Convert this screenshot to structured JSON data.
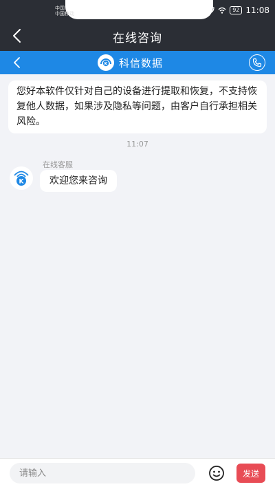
{
  "status_bar": {
    "carrier_line1": "中国",
    "carrier_line2": "中国移动",
    "battery": "92",
    "time": "11:08"
  },
  "nav": {
    "title": "在线咨询"
  },
  "sub_nav": {
    "brand_name": "科信数据",
    "accent_color": "#1e88e5"
  },
  "chat": {
    "notice": "您好本软件仅针对自己的设备进行提取和恢复，不支持恢复他人数据，如果涉及隐私等问题，由客户自行承担相关风险。",
    "timestamp": "11:07",
    "agent_name": "在线客服",
    "agent_message": "欢迎您来咨询"
  },
  "input_bar": {
    "placeholder": "请输入",
    "send_label": "发送",
    "send_color": "#e84c55"
  },
  "icons": [
    "back-arrow-icon",
    "brand-logo-icon",
    "phone-icon",
    "emoji-icon",
    "wifi-icon",
    "battery-icon"
  ]
}
